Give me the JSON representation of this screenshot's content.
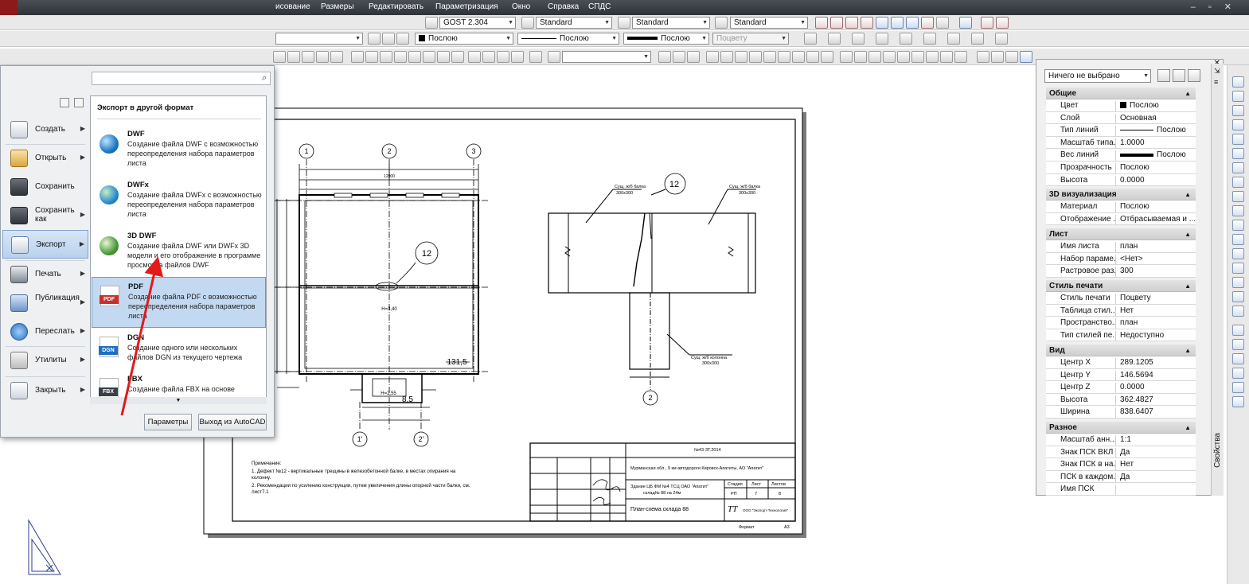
{
  "menubar": {
    "items": [
      "исование",
      "Размеры",
      "Редактировать",
      "Параметризация",
      "Окно",
      "Справка",
      "СПДС"
    ]
  },
  "toolbar": {
    "text_style": "GOST 2.304",
    "dim_style": "Standard",
    "table_style": "Standard",
    "mleader_style": "Standard",
    "color": "Послою",
    "linetype": "Послою",
    "lineweight": "Послою",
    "plotstyle": "Поцвету"
  },
  "app_menu": {
    "nav": [
      {
        "label": "Создать",
        "icon": "new-doc-icon"
      },
      {
        "label": "Открыть",
        "icon": "open-folder-icon"
      },
      {
        "label": "Сохранить",
        "icon": "save-icon"
      },
      {
        "label": "Сохранить как",
        "icon": "save-as-icon"
      },
      {
        "label": "Экспорт",
        "icon": "export-icon"
      },
      {
        "label": "Печать",
        "icon": "print-icon"
      },
      {
        "label": "Публикация",
        "icon": "publish-icon"
      },
      {
        "label": "Переслать",
        "icon": "send-icon"
      },
      {
        "label": "Утилиты",
        "icon": "utilities-icon"
      },
      {
        "label": "Закрыть",
        "icon": "close-folder-icon"
      }
    ],
    "submenu_title": "Экспорт в другой формат",
    "formats": [
      {
        "title": "DWF",
        "desc": "Создание файла DWF с возможностью переопределения набора параметров листа",
        "icon": "dwf-globe-icon"
      },
      {
        "title": "DWFx",
        "desc": "Создание файла DWFx с возможностью переопределения набора параметров листа",
        "icon": "dwfx-globe-icon"
      },
      {
        "title": "3D DWF",
        "desc": "Создание файла DWF или DWFx 3D модели и его отображение в программе просмотра файлов DWF",
        "icon": "3d-dwf-icon"
      },
      {
        "title": "PDF",
        "desc": "Создание файла PDF с возможностью переопределения набора параметров листа",
        "icon": "pdf-icon",
        "badge": "PDF"
      },
      {
        "title": "DGN",
        "desc": "Создание одного или нескольких файлов DGN из текущего чертежа",
        "icon": "dgn-icon",
        "badge": "DGN"
      },
      {
        "title": "FBX",
        "desc": "Создание файла FBX на основе текущего чертежа",
        "icon": "fbx-icon",
        "badge": "FBX"
      }
    ],
    "params_button": "Параметры",
    "exit_button": "Выход из AutoCAD"
  },
  "properties": {
    "selection": "Ничего не выбрано",
    "side_title": "Свойства",
    "sections": [
      {
        "title": "Общие",
        "rows": [
          {
            "k": "Цвет",
            "v": "Послою",
            "glyph": "square"
          },
          {
            "k": "Слой",
            "v": "Основная"
          },
          {
            "k": "Тип линий",
            "v": "Послою",
            "glyph": "line"
          },
          {
            "k": "Масштаб типа...",
            "v": "1.0000"
          },
          {
            "k": "Вес линий",
            "v": "Послою",
            "glyph": "thick"
          },
          {
            "k": "Прозрачность",
            "v": "Послою"
          },
          {
            "k": "Высота",
            "v": "0.0000"
          }
        ]
      },
      {
        "title": "3D визуализация",
        "rows": [
          {
            "k": "Материал",
            "v": "Послою"
          },
          {
            "k": "Отображение ...",
            "v": "Отбрасываемая и ..."
          }
        ]
      },
      {
        "title": "Лист",
        "rows": [
          {
            "k": "Имя листа",
            "v": "план"
          },
          {
            "k": "Набор параме...",
            "v": "<Нет>"
          },
          {
            "k": "Растровое раз...",
            "v": "300"
          }
        ]
      },
      {
        "title": "Стиль печати",
        "rows": [
          {
            "k": "Стиль печати",
            "v": "Поцвету"
          },
          {
            "k": "Таблица стил...",
            "v": "Нет"
          },
          {
            "k": "Пространство...",
            "v": "план"
          },
          {
            "k": "Тип стилей пе...",
            "v": "Недоступно"
          }
        ]
      },
      {
        "title": "Вид",
        "rows": [
          {
            "k": "Центр X",
            "v": "289.1205"
          },
          {
            "k": "Центр Y",
            "v": "146.5694"
          },
          {
            "k": "Центр Z",
            "v": "0.0000"
          },
          {
            "k": "Высота",
            "v": "362.4827"
          },
          {
            "k": "Ширина",
            "v": "838.6407"
          }
        ]
      },
      {
        "title": "Разное",
        "rows": [
          {
            "k": "Масштаб анн...",
            "v": "1:1"
          },
          {
            "k": "Знак ПСК ВКЛ",
            "v": "Да"
          },
          {
            "k": "Знак ПСК в на...",
            "v": "Нет"
          },
          {
            "k": "ПСК в каждом...",
            "v": "Да"
          },
          {
            "k": "Имя ПСК",
            "v": ""
          }
        ]
      }
    ]
  },
  "drawing": {
    "axes_top": [
      "1",
      "2",
      "3"
    ],
    "axes_bottom": [
      "1'",
      "2'"
    ],
    "axis_a": "A'",
    "defect_callout": "12",
    "area": "131,5",
    "porch_area": "8,5",
    "level_h1": "H=3,40",
    "level_h2": "H=2,55",
    "dim_a": "12000",
    "beam_label_left": "Сущ. ж/б балка",
    "beam_size_left": "300х300",
    "beam_label_right": "Сущ. ж/б балка",
    "beam_size_right": "300х300",
    "column_label": "Сущ. ж/б колонна",
    "column_size": "300х300",
    "section_axis": "2",
    "notes_title": "Примечание:",
    "note_1": "1. Дефект №12 - вертикальные трещины в железобетонной балке, в местах опирания на",
    "note_1b": "колонну.",
    "note_2": "2. Рекомендации по усилению конструкции, путем увеличения длины опорной части балки, см.",
    "note_2b": "лист7.1",
    "title_code": "№43-ЗТ.2014",
    "title_object": "Мурманская обл., 9 км автодороги Кировск-Апатиты, АО \"Апатит\"",
    "title_building": "Здание ЦБ ФМ №4 ТСЦ ОАО \"Апатит\"",
    "title_building_b": "склад№ 88 на 24м",
    "title_sheet_name": "План-схема склада 88",
    "stage_h": "Стадия",
    "sheet_h": "Лист",
    "sheets_h": "Листов",
    "stage": "РП",
    "sheet": "7",
    "sheets": "8",
    "company": "ООО \"Экспорт-Технология\"",
    "format_label": "Формат",
    "format_value": "А3"
  }
}
